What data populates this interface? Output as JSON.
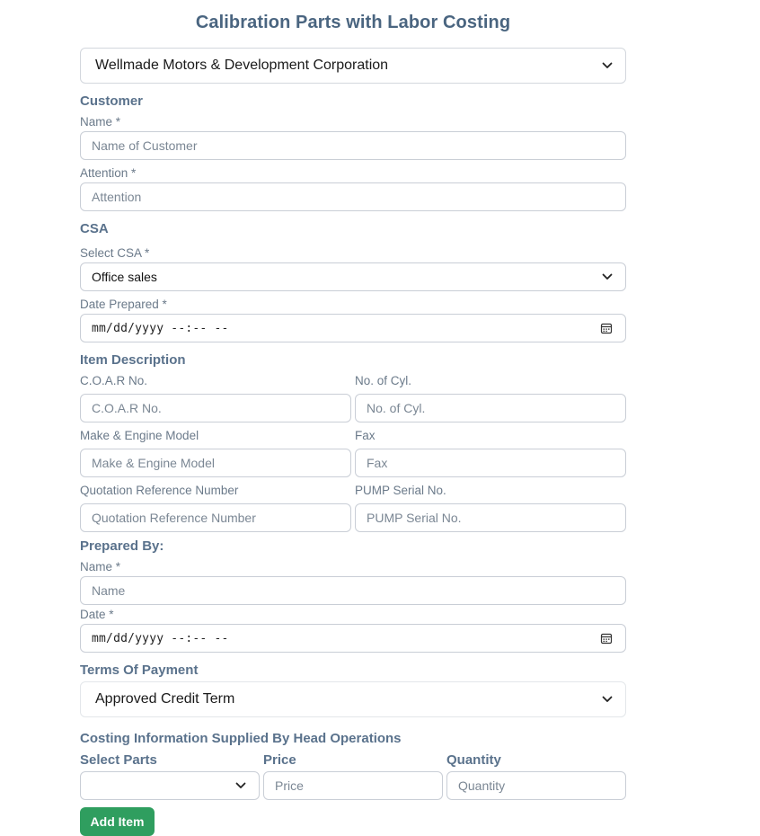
{
  "header": {
    "title": "Calibration Parts with Labor Costing"
  },
  "company_select": {
    "value": "Wellmade Motors & Development Corporation"
  },
  "customer": {
    "section_title": "Customer",
    "name_label": "Name *",
    "name_placeholder": "Name of Customer",
    "attention_label": "Attention *",
    "attention_placeholder": "Attention"
  },
  "csa": {
    "section_title": "CSA",
    "select_label": "Select CSA *",
    "select_value": "Office sales",
    "date_label": "Date Prepared *",
    "date_value": "mm/dd/yyyy --:-- --"
  },
  "item_description": {
    "section_title": "Item Description",
    "coar_label": "C.O.A.R No.",
    "coar_placeholder": "C.O.A.R No.",
    "cyl_label": "No. of Cyl.",
    "cyl_placeholder": "No. of Cyl.",
    "make_label": "Make & Engine Model",
    "make_placeholder": "Make & Engine Model",
    "fax_label": "Fax",
    "fax_placeholder": "Fax",
    "quote_label": "Quotation Reference Number",
    "quote_placeholder": "Quotation Reference Number",
    "pump_label": "PUMP Serial No.",
    "pump_placeholder": "PUMP Serial No."
  },
  "prepared_by": {
    "section_title": "Prepared By:",
    "name_label": "Name *",
    "name_placeholder": "Name",
    "date_label": "Date *",
    "date_value": "mm/dd/yyyy --:-- --"
  },
  "terms": {
    "section_title": "Terms Of Payment",
    "select_value": "Approved Credit Term"
  },
  "costing": {
    "section_title": "Costing Information Supplied By Head Operations",
    "parts_label": "Select Parts",
    "parts_value": "",
    "price_label": "Price",
    "price_placeholder": "Price",
    "quantity_label": "Quantity",
    "quantity_placeholder": "Quantity",
    "add_button": "Add Item"
  },
  "icons": {
    "dropdown": "chevron-down-icon",
    "date": "calendar-icon"
  },
  "colors": {
    "title": "#4a6580",
    "section": "#5a728c",
    "add_button": "#2f9e5f"
  }
}
